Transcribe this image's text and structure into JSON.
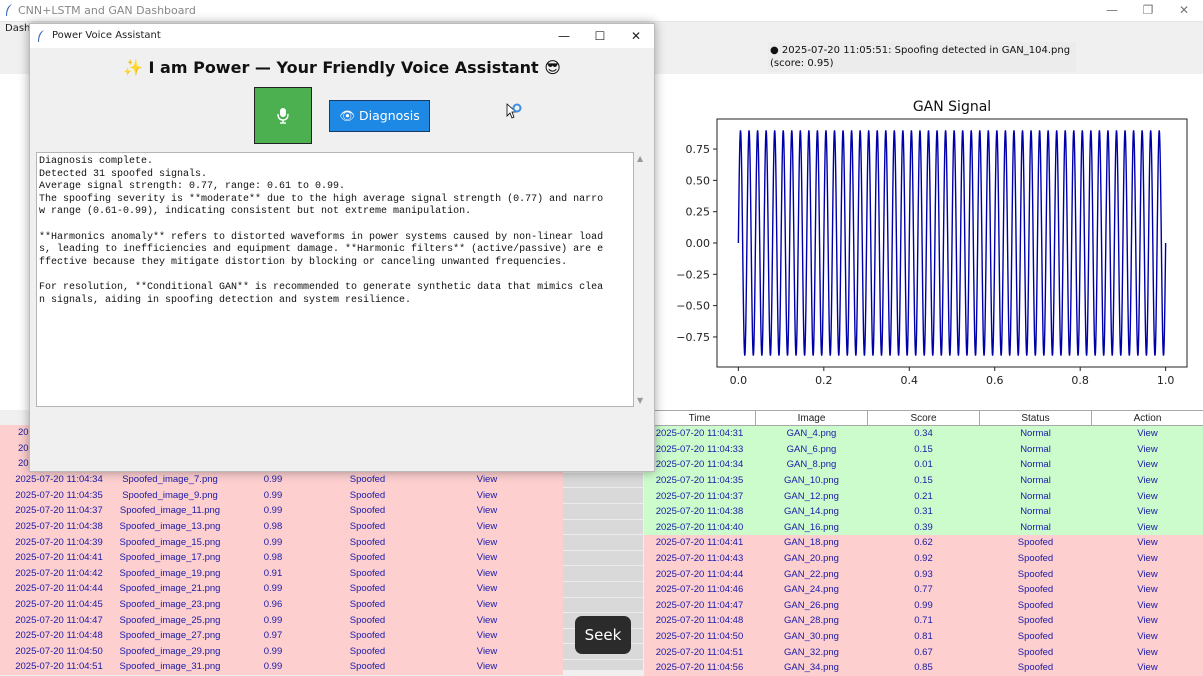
{
  "main_window": {
    "title": "CNN+LSTM and GAN Dashboard",
    "menu_label": "Dashb",
    "minimize": "—",
    "maximize": "❐",
    "close": "✕",
    "status_message": "● 2025-07-20 11:05:51: Spoofing detected in GAN_104.png (score: 0.95)"
  },
  "dialog": {
    "title": "Power Voice Assistant",
    "heading": "✨ I am Power — Your Friendly Voice Assistant 😎",
    "minimize": "—",
    "maximize": "☐",
    "close": "✕",
    "diagnosis_label": "👁 Diagnosis",
    "output_lines": [
      "Diagnosis complete.",
      "Detected 31 spoofed signals.",
      "Average signal strength: 0.77, range: 0.61 to 0.99.",
      "The spoofing severity is **moderate** due to the high average signal strength (0.77) and narro",
      "w range (0.61-0.99), indicating consistent but not extreme manipulation.",
      "",
      "**Harmonics anomaly** refers to distorted waveforms in power systems caused by non-linear load",
      "s, leading to inefficiencies and equipment damage. **Harmonic filters** (active/passive) are e",
      "ffective because they mitigate distortion by blocking or canceling unwanted frequencies.",
      "",
      "For resolution, **Conditional GAN** is recommended to generate synthetic data that mimics clea",
      "n signals, aiding in spoofing detection and system resilience."
    ]
  },
  "seek_label": "Seek",
  "colors": {
    "spoofed": "#fdcfcf",
    "normal": "#ccfccc",
    "link": "#1a1aa8",
    "signal": "#0000aa"
  },
  "left_table": {
    "partial_rows": [
      "20",
      "20",
      "20"
    ],
    "rows": [
      {
        "time": "2025-07-20 11:04:34",
        "image": "Spoofed_image_7.png",
        "score": "0.99",
        "status": "Spoofed",
        "action": "View"
      },
      {
        "time": "2025-07-20 11:04:35",
        "image": "Spoofed_image_9.png",
        "score": "0.99",
        "status": "Spoofed",
        "action": "View"
      },
      {
        "time": "2025-07-20 11:04:37",
        "image": "Spoofed_image_11.png",
        "score": "0.99",
        "status": "Spoofed",
        "action": "View"
      },
      {
        "time": "2025-07-20 11:04:38",
        "image": "Spoofed_image_13.png",
        "score": "0.98",
        "status": "Spoofed",
        "action": "View"
      },
      {
        "time": "2025-07-20 11:04:39",
        "image": "Spoofed_image_15.png",
        "score": "0.99",
        "status": "Spoofed",
        "action": "View"
      },
      {
        "time": "2025-07-20 11:04:41",
        "image": "Spoofed_image_17.png",
        "score": "0.98",
        "status": "Spoofed",
        "action": "View"
      },
      {
        "time": "2025-07-20 11:04:42",
        "image": "Spoofed_image_19.png",
        "score": "0.91",
        "status": "Spoofed",
        "action": "View"
      },
      {
        "time": "2025-07-20 11:04:44",
        "image": "Spoofed_image_21.png",
        "score": "0.99",
        "status": "Spoofed",
        "action": "View"
      },
      {
        "time": "2025-07-20 11:04:45",
        "image": "Spoofed_image_23.png",
        "score": "0.96",
        "status": "Spoofed",
        "action": "View"
      },
      {
        "time": "2025-07-20 11:04:47",
        "image": "Spoofed_image_25.png",
        "score": "0.99",
        "status": "Spoofed",
        "action": "View"
      },
      {
        "time": "2025-07-20 11:04:48",
        "image": "Spoofed_image_27.png",
        "score": "0.97",
        "status": "Spoofed",
        "action": "View"
      },
      {
        "time": "2025-07-20 11:04:50",
        "image": "Spoofed_image_29.png",
        "score": "0.99",
        "status": "Spoofed",
        "action": "View"
      },
      {
        "time": "2025-07-20 11:04:51",
        "image": "Spoofed_image_31.png",
        "score": "0.99",
        "status": "Spoofed",
        "action": "View"
      }
    ]
  },
  "right_table": {
    "headers": [
      "Time",
      "Image",
      "Score",
      "Status",
      "Action"
    ],
    "rows": [
      {
        "time": "2025-07-20 11:04:31",
        "image": "GAN_4.png",
        "score": "0.34",
        "status": "Normal",
        "action": "View"
      },
      {
        "time": "2025-07-20 11:04:33",
        "image": "GAN_6.png",
        "score": "0.15",
        "status": "Normal",
        "action": "View"
      },
      {
        "time": "2025-07-20 11:04:34",
        "image": "GAN_8.png",
        "score": "0.01",
        "status": "Normal",
        "action": "View"
      },
      {
        "time": "2025-07-20 11:04:35",
        "image": "GAN_10.png",
        "score": "0.15",
        "status": "Normal",
        "action": "View"
      },
      {
        "time": "2025-07-20 11:04:37",
        "image": "GAN_12.png",
        "score": "0.21",
        "status": "Normal",
        "action": "View"
      },
      {
        "time": "2025-07-20 11:04:38",
        "image": "GAN_14.png",
        "score": "0.31",
        "status": "Normal",
        "action": "View"
      },
      {
        "time": "2025-07-20 11:04:40",
        "image": "GAN_16.png",
        "score": "0.39",
        "status": "Normal",
        "action": "View"
      },
      {
        "time": "2025-07-20 11:04:41",
        "image": "GAN_18.png",
        "score": "0.62",
        "status": "Spoofed",
        "action": "View"
      },
      {
        "time": "2025-07-20 11:04:43",
        "image": "GAN_20.png",
        "score": "0.92",
        "status": "Spoofed",
        "action": "View"
      },
      {
        "time": "2025-07-20 11:04:44",
        "image": "GAN_22.png",
        "score": "0.93",
        "status": "Spoofed",
        "action": "View"
      },
      {
        "time": "2025-07-20 11:04:46",
        "image": "GAN_24.png",
        "score": "0.77",
        "status": "Spoofed",
        "action": "View"
      },
      {
        "time": "2025-07-20 11:04:47",
        "image": "GAN_26.png",
        "score": "0.99",
        "status": "Spoofed",
        "action": "View"
      },
      {
        "time": "2025-07-20 11:04:48",
        "image": "GAN_28.png",
        "score": "0.71",
        "status": "Spoofed",
        "action": "View"
      },
      {
        "time": "2025-07-20 11:04:50",
        "image": "GAN_30.png",
        "score": "0.81",
        "status": "Spoofed",
        "action": "View"
      },
      {
        "time": "2025-07-20 11:04:51",
        "image": "GAN_32.png",
        "score": "0.67",
        "status": "Spoofed",
        "action": "View"
      },
      {
        "time": "2025-07-20 11:04:56",
        "image": "GAN_34.png",
        "score": "0.85",
        "status": "Spoofed",
        "action": "View"
      }
    ]
  },
  "chart_data": {
    "type": "line",
    "title": "GAN Signal",
    "xlabel": "",
    "ylabel": "",
    "xlim": [
      0.0,
      1.0
    ],
    "ylim": [
      -0.9,
      0.9
    ],
    "x_ticks": [
      "0.0",
      "0.2",
      "0.4",
      "0.6",
      "0.8",
      "1.0"
    ],
    "y_ticks": [
      "0.75",
      "0.50",
      "0.25",
      "0.00",
      "−0.25",
      "−0.50",
      "−0.75"
    ],
    "x_tick_values": [
      0.0,
      0.2,
      0.4,
      0.6,
      0.8,
      1.0
    ],
    "y_tick_values": [
      0.75,
      0.5,
      0.25,
      0.0,
      -0.25,
      -0.5,
      -0.75
    ],
    "signal": "sine",
    "amplitude": 0.9,
    "frequency": 50,
    "grid": false
  }
}
